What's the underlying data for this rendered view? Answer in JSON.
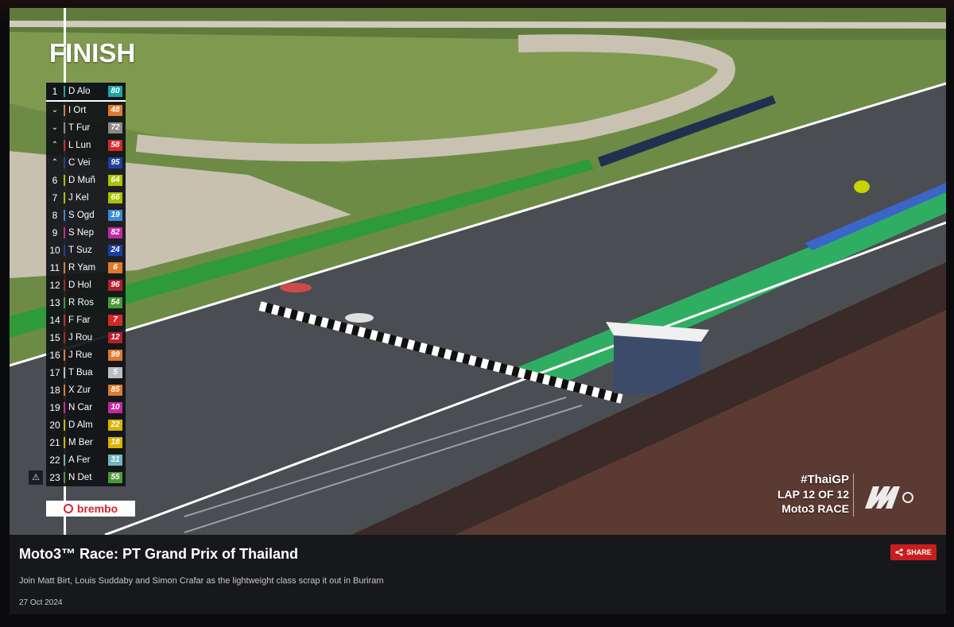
{
  "video": {
    "finish_label": "FINISH",
    "leaderboard": [
      {
        "pos": "1",
        "marker": "",
        "name": "D Alo",
        "num": "80",
        "color": "#1fa3a6"
      },
      {
        "pos": "",
        "marker": "down",
        "name": "I Ort",
        "num": "48",
        "color": "#e07a2a"
      },
      {
        "pos": "",
        "marker": "down",
        "name": "T Fur",
        "num": "72",
        "color": "#8a8a8a"
      },
      {
        "pos": "",
        "marker": "up",
        "name": "L Lun",
        "num": "58",
        "color": "#d42a2a"
      },
      {
        "pos": "",
        "marker": "up",
        "name": "C Vei",
        "num": "95",
        "color": "#1e3fa0"
      },
      {
        "pos": "6",
        "marker": "",
        "name": "D Muñ",
        "num": "64",
        "color": "#a9c400"
      },
      {
        "pos": "7",
        "marker": "",
        "name": "J Kel",
        "num": "66",
        "color": "#a9c400"
      },
      {
        "pos": "8",
        "marker": "",
        "name": "S Ogd",
        "num": "19",
        "color": "#3a8ad6"
      },
      {
        "pos": "9",
        "marker": "",
        "name": "S Nep",
        "num": "82",
        "color": "#c429a3"
      },
      {
        "pos": "10",
        "marker": "",
        "name": "T Suz",
        "num": "24",
        "color": "#1e3fa0"
      },
      {
        "pos": "11",
        "marker": "",
        "name": "R Yam",
        "num": "6",
        "color": "#e07a2a"
      },
      {
        "pos": "12",
        "marker": "",
        "name": "D Hol",
        "num": "96",
        "color": "#b3202c"
      },
      {
        "pos": "13",
        "marker": "",
        "name": "R Ros",
        "num": "54",
        "color": "#4a9a3a"
      },
      {
        "pos": "14",
        "marker": "",
        "name": "F Far",
        "num": "7",
        "color": "#d42a2a"
      },
      {
        "pos": "15",
        "marker": "",
        "name": "J Rou",
        "num": "12",
        "color": "#b3202c"
      },
      {
        "pos": "16",
        "marker": "",
        "name": "J Rue",
        "num": "99",
        "color": "#e07a2a"
      },
      {
        "pos": "17",
        "marker": "",
        "name": "T Bua",
        "num": "5",
        "color": "#bdbdbd"
      },
      {
        "pos": "18",
        "marker": "",
        "name": "X Zur",
        "num": "85",
        "color": "#e07a2a"
      },
      {
        "pos": "19",
        "marker": "",
        "name": "N Car",
        "num": "10",
        "color": "#c429a3"
      },
      {
        "pos": "20",
        "marker": "",
        "name": "D Alm",
        "num": "22",
        "color": "#d9b400"
      },
      {
        "pos": "21",
        "marker": "",
        "name": "M Ber",
        "num": "18",
        "color": "#d9b400"
      },
      {
        "pos": "22",
        "marker": "",
        "name": "A Fer",
        "num": "31",
        "color": "#6fb7bd"
      },
      {
        "pos": "23",
        "marker": "",
        "name": "N Det",
        "num": "55",
        "color": "#4a9a3a"
      }
    ],
    "sponsor_label": "brembo",
    "hashtag": "#ThaiGP",
    "lap_label": "LAP 12 OF 12",
    "race_label": "Moto3 RACE",
    "broadcaster_logo": "motogp"
  },
  "info": {
    "title": "Moto3™ Race: PT Grand Prix of Thailand",
    "description": "Join Matt Birt, Louis Suddaby and Simon Crafar as the lightweight class scrap it out in Buriram",
    "date": "27 Oct 2024",
    "share_label": "SHARE"
  }
}
